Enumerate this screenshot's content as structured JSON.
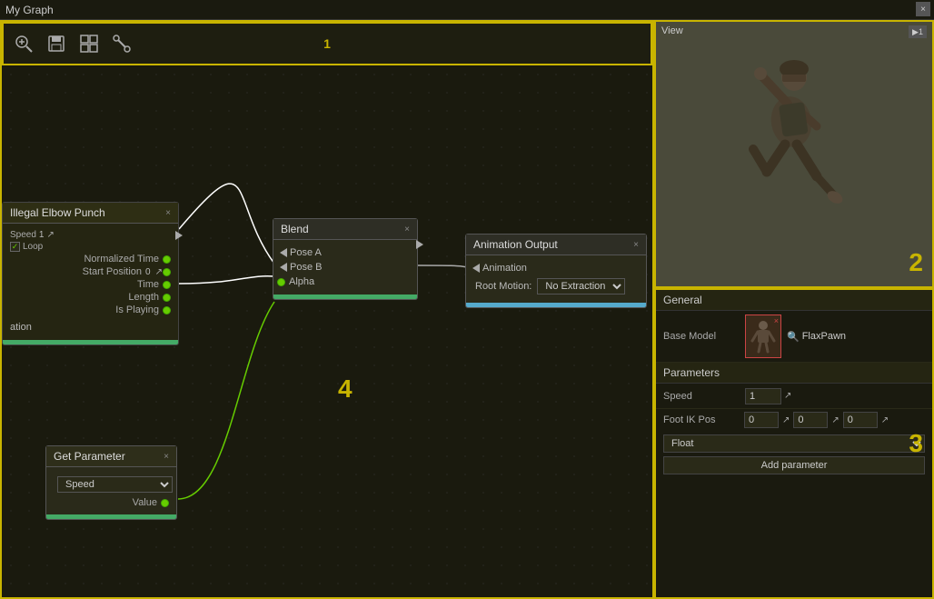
{
  "titlebar": {
    "title": "My Graph",
    "close_label": "×"
  },
  "toolbar": {
    "label": "1",
    "icons": [
      "search",
      "save",
      "frame",
      "bone"
    ]
  },
  "graph": {
    "area_label": "4",
    "nodes": {
      "iep": {
        "title": "Illegal Elbow Punch",
        "close": "×",
        "params": {
          "loop": "Loop",
          "loop_checked": true,
          "normalized_time": "Normalized Time",
          "start_position": "Start Position",
          "start_position_value": "0",
          "time": "Time",
          "length": "Length",
          "is_playing": "Is Playing",
          "speed_label": "Speed",
          "speed_value": "1"
        }
      },
      "blend": {
        "title": "Blend",
        "close": "×",
        "pose_a": "Pose A",
        "pose_b": "Pose B",
        "alpha": "Alpha"
      },
      "anim_output": {
        "title": "Animation Output",
        "close": "×",
        "animation": "Animation",
        "root_motion": "Root Motion:",
        "no_extraction": "No Extraction"
      },
      "get_param": {
        "title": "Get Parameter",
        "close": "×",
        "param_name": "Speed",
        "value_label": "Value"
      }
    }
  },
  "view_panel": {
    "label": "View",
    "badge": "1",
    "area_label": "2"
  },
  "properties": {
    "area_label": "3",
    "general_header": "General",
    "base_model_label": "Base Model",
    "base_model_name": "FlaxPawn",
    "parameters_header": "Parameters",
    "speed_label": "Speed",
    "speed_value": "1",
    "foot_ik_label": "Foot IK Pos",
    "foot_ik_values": [
      "0",
      "0",
      "0"
    ],
    "float_label": "Float",
    "add_param_label": "Add parameter"
  }
}
